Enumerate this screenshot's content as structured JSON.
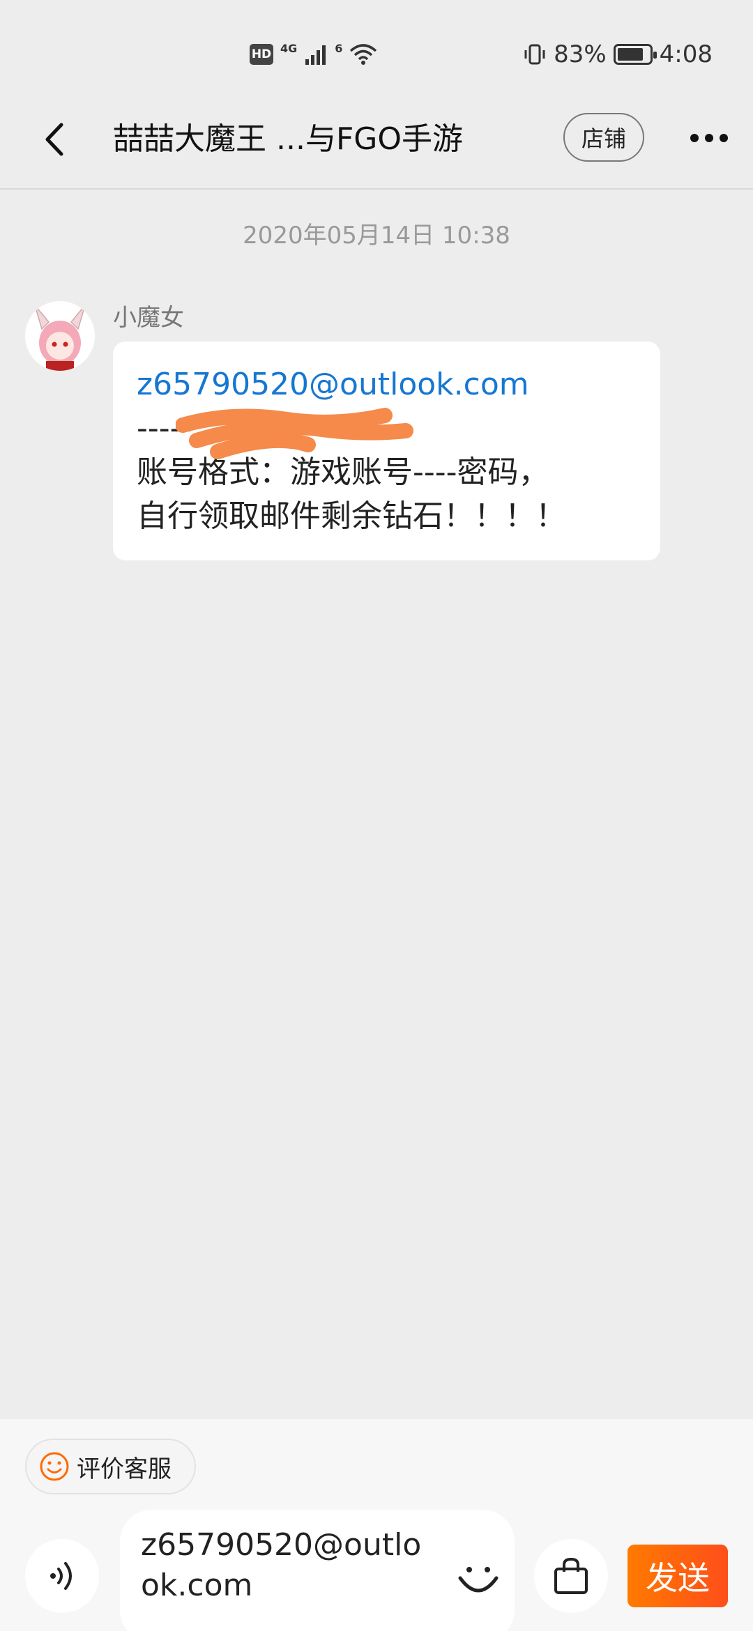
{
  "status_bar": {
    "hd_label": "HD",
    "net_label": "4G",
    "wifi_label": "6",
    "battery_percent_text": "83%",
    "battery_level": 0.83,
    "time": "4:08"
  },
  "header": {
    "title": "喆喆大魔王 ...与FGO手游",
    "shop_label": "店铺"
  },
  "chat": {
    "timestamp": "2020年05月14日 10:38",
    "sender_name": "小魔女",
    "message": {
      "email": "z65790520@outlook.com",
      "line2": "-----",
      "line3": "账号格式：游戏账号----密码，",
      "line4": "自行领取邮件剩余钻石！！！！"
    }
  },
  "bottom_bar": {
    "evaluate_label": "评价客服",
    "input_value": "z65790520@outlook.com",
    "send_label": "发送"
  },
  "colors": {
    "accent": "#ff6a00",
    "link": "#1677d2",
    "scribble": "#f58a4b"
  },
  "icons": [
    "back-arrow-icon",
    "more-dots-icon",
    "smiley-icon",
    "voice-icon",
    "emoji-icon",
    "shopping-bag-icon"
  ]
}
